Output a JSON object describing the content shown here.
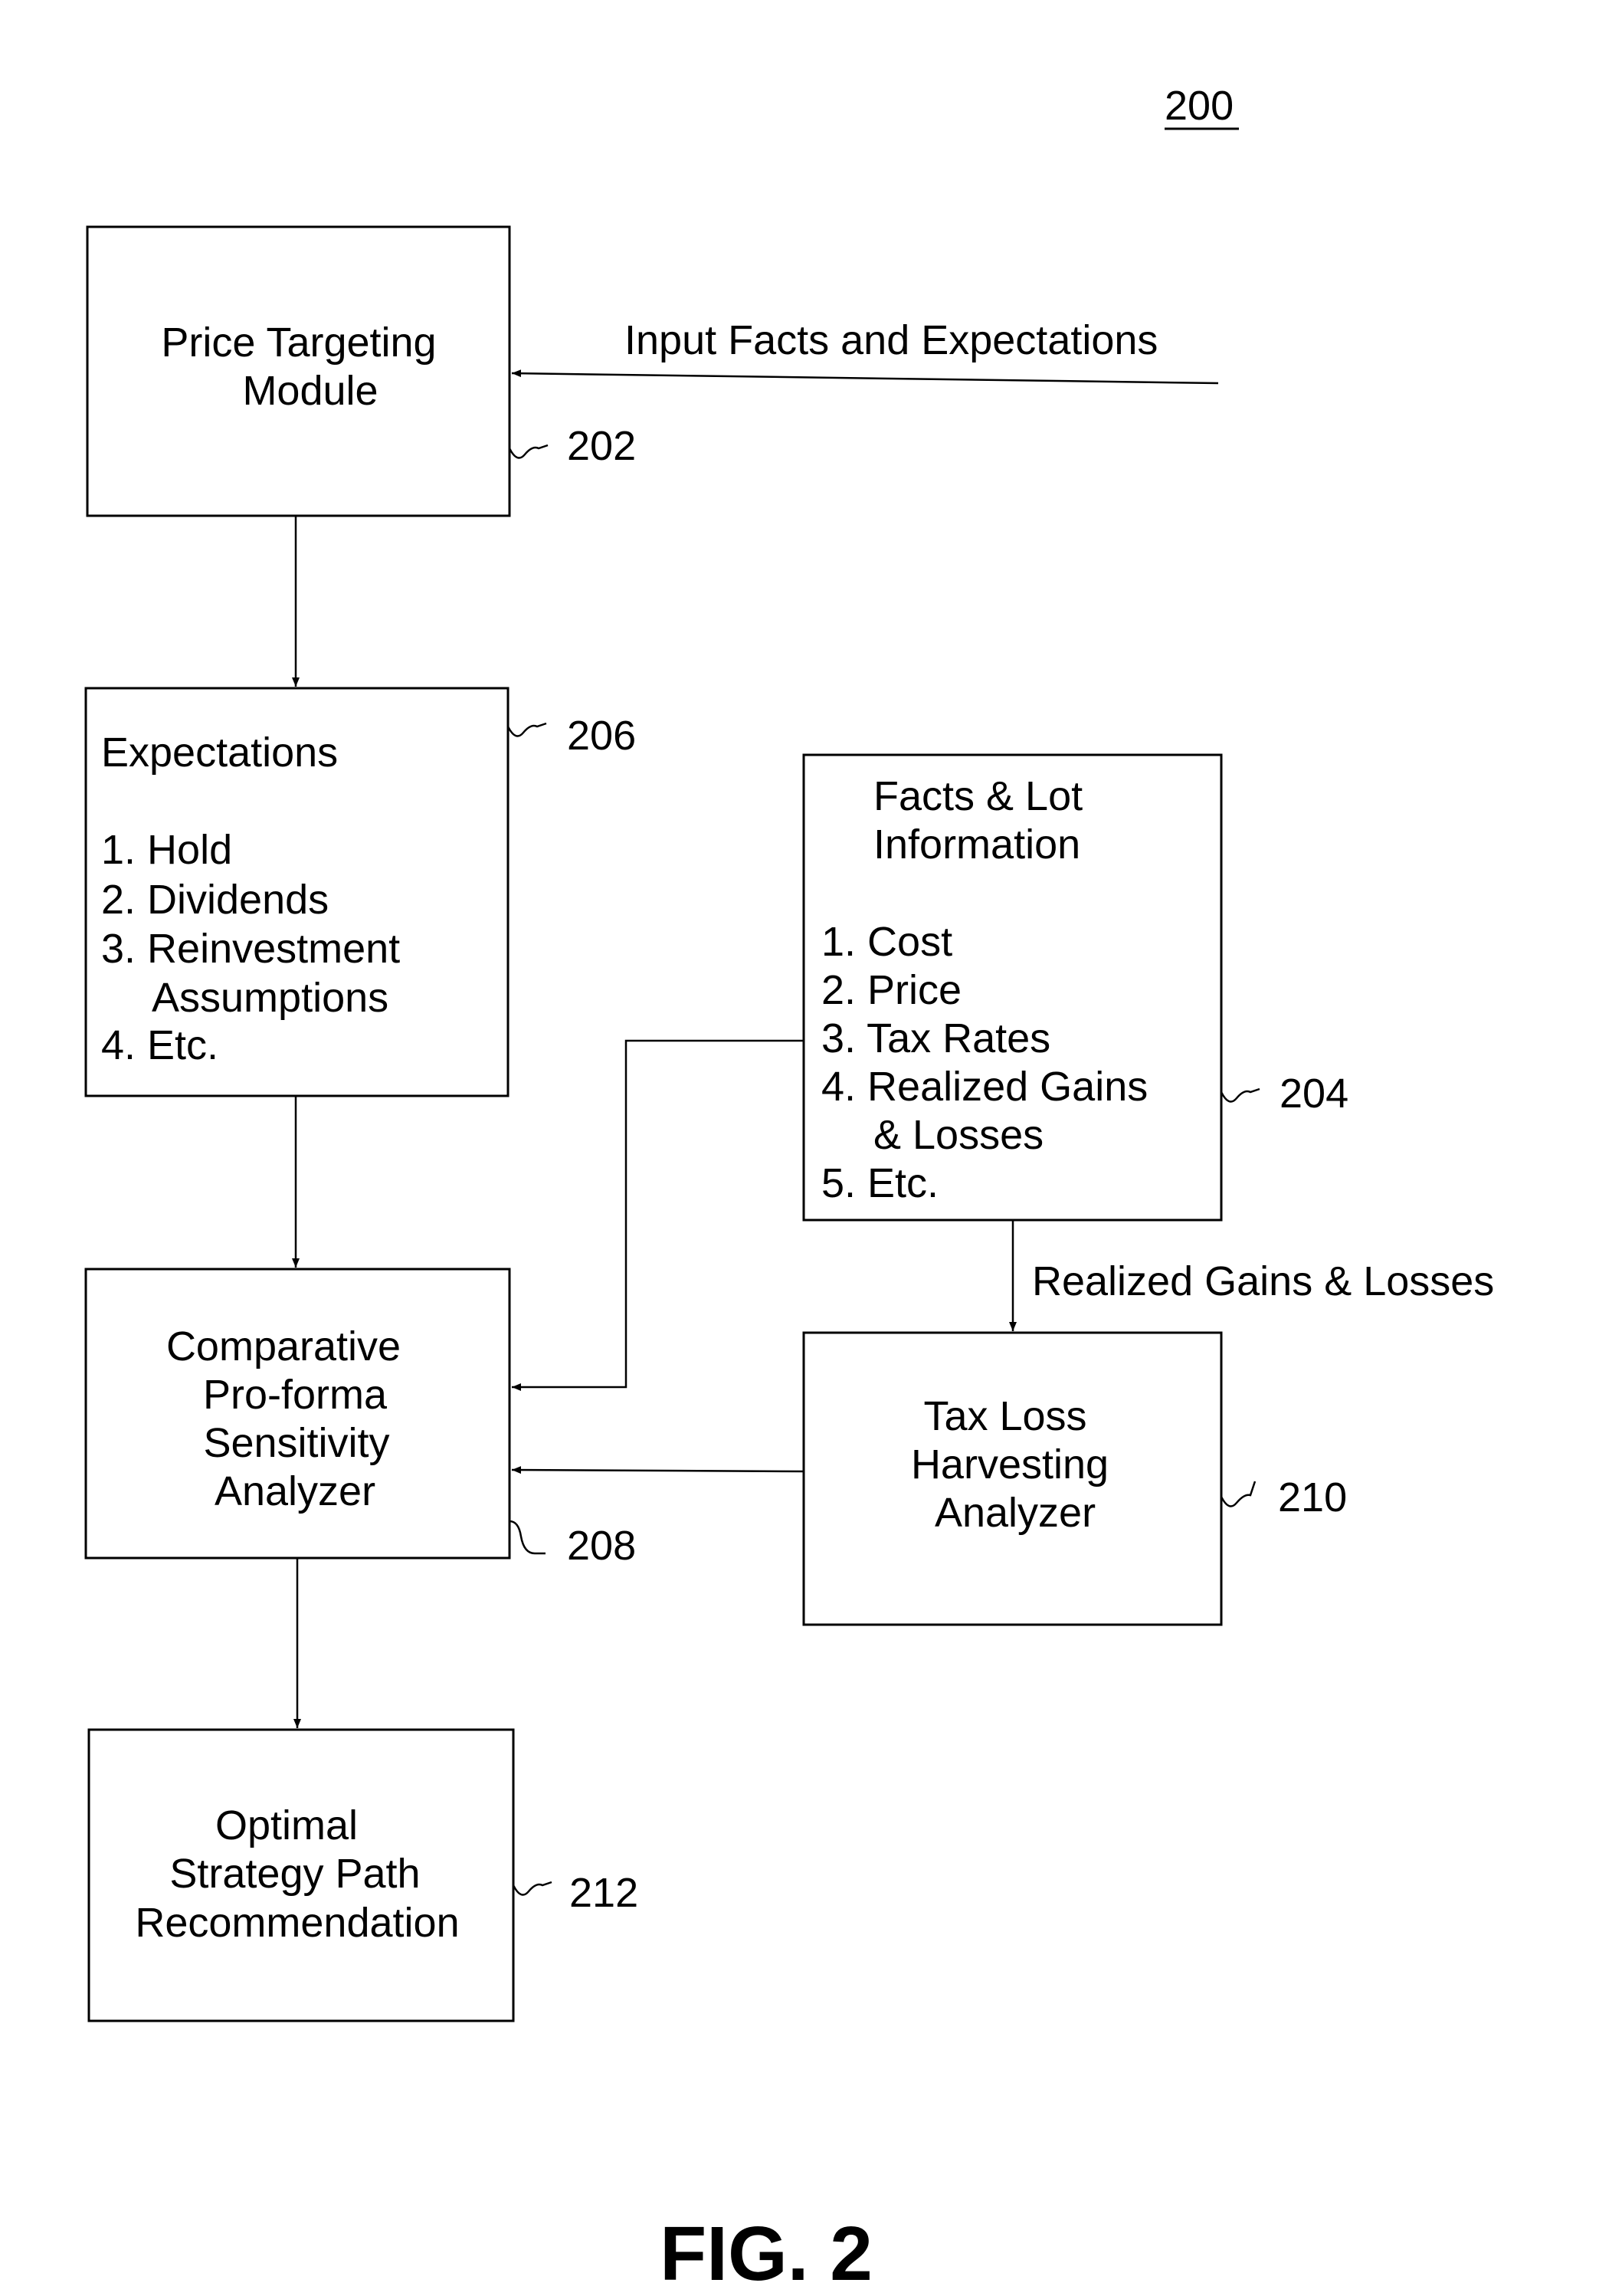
{
  "figure": {
    "number_label": "200",
    "caption": "FIG. 2"
  },
  "input": {
    "label": "Input Facts and Expectations"
  },
  "blocks": {
    "price_targeting": {
      "ref": "202",
      "lines": [
        "Price Targeting",
        "Module"
      ]
    },
    "expectations": {
      "ref": "206",
      "title": "Expectations",
      "items": [
        "1. Hold",
        "2. Dividends",
        "3. Reinvestment",
        "Assumptions",
        "4. Etc."
      ]
    },
    "facts_lot": {
      "ref": "204",
      "title_lines": [
        "Facts & Lot",
        "Information"
      ],
      "items": [
        "1. Cost",
        "2. Price",
        "3. Tax Rates",
        "4. Realized Gains",
        "& Losses",
        "5. Etc."
      ]
    },
    "comparative": {
      "ref": "208",
      "lines": [
        "Comparative",
        "Pro-forma",
        "Sensitivity",
        "Analyzer"
      ]
    },
    "tax_loss": {
      "ref": "210",
      "lines": [
        "Tax Loss",
        "Harvesting",
        "Analyzer"
      ]
    },
    "optimal": {
      "ref": "212",
      "lines": [
        "Optimal",
        "Strategy Path",
        "Recommendation"
      ]
    }
  },
  "edges": {
    "realized_label": "Realized Gains & Losses"
  }
}
